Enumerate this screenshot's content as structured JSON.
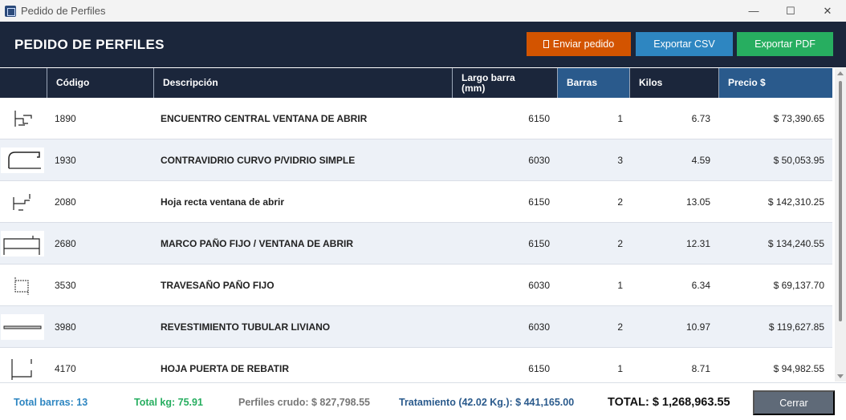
{
  "window": {
    "title": "Pedido de Perfiles",
    "controls": {
      "minimize": "—",
      "maximize": "☐",
      "close": "✕"
    }
  },
  "header": {
    "title": "PEDIDO DE PERFILES",
    "buttons": {
      "send": "Enviar  pedido",
      "csv": "Exportar CSV",
      "pdf": "Exportar PDF"
    },
    "colors": {
      "send": "#d35400",
      "csv": "#2e86c1",
      "pdf": "#27ae60",
      "bar": "#1b263b"
    }
  },
  "table": {
    "columns": [
      "",
      "Código",
      "Descripción",
      "Largo barra\n(mm)",
      "Barras",
      "Kilos",
      "Precio $"
    ],
    "rows": [
      {
        "icon": "profile-1890-icon",
        "code": "1890",
        "desc": "ENCUENTRO CENTRAL VENTANA DE ABRIR",
        "largo": "6150",
        "barras": "1",
        "kilos": "6.73",
        "precio": "$ 73,390.65"
      },
      {
        "icon": "profile-1930-icon",
        "code": "1930",
        "desc": "CONTRAVIDRIO CURVO P/VIDRIO SIMPLE",
        "largo": "6030",
        "barras": "3",
        "kilos": "4.59",
        "precio": "$ 50,053.95"
      },
      {
        "icon": "profile-2080-icon",
        "code": "2080",
        "desc": "Hoja recta ventana de abrir",
        "largo": "6150",
        "barras": "2",
        "kilos": "13.05",
        "precio": "$ 142,310.25"
      },
      {
        "icon": "profile-2680-icon",
        "code": "2680",
        "desc": "MARCO PAÑO FIJO / VENTANA DE ABRIR",
        "largo": "6150",
        "barras": "2",
        "kilos": "12.31",
        "precio": "$ 134,240.55"
      },
      {
        "icon": "profile-3530-icon",
        "code": "3530",
        "desc": "TRAVESAÑO PAÑO FIJO",
        "largo": "6030",
        "barras": "1",
        "kilos": "6.34",
        "precio": "$ 69,137.70"
      },
      {
        "icon": "profile-3980-icon",
        "code": "3980",
        "desc": "REVESTIMIENTO TUBULAR LIVIANO",
        "largo": "6030",
        "barras": "2",
        "kilos": "10.97",
        "precio": "$ 119,627.85"
      },
      {
        "icon": "profile-4170-icon",
        "code": "4170",
        "desc": "HOJA PUERTA DE REBATIR",
        "largo": "6150",
        "barras": "1",
        "kilos": "8.71",
        "precio": "$ 94,982.55"
      }
    ]
  },
  "footer": {
    "total_barras": "Total barras:  13",
    "total_kg": "Total kg:  75.91",
    "perfiles_crudo": "Perfiles crudo:  $ 827,798.55",
    "tratamiento": "Tratamiento (42.02 Kg.):  $ 441,165.00",
    "total": "TOTAL:  $ 1,268,963.55",
    "close": "Cerrar"
  }
}
